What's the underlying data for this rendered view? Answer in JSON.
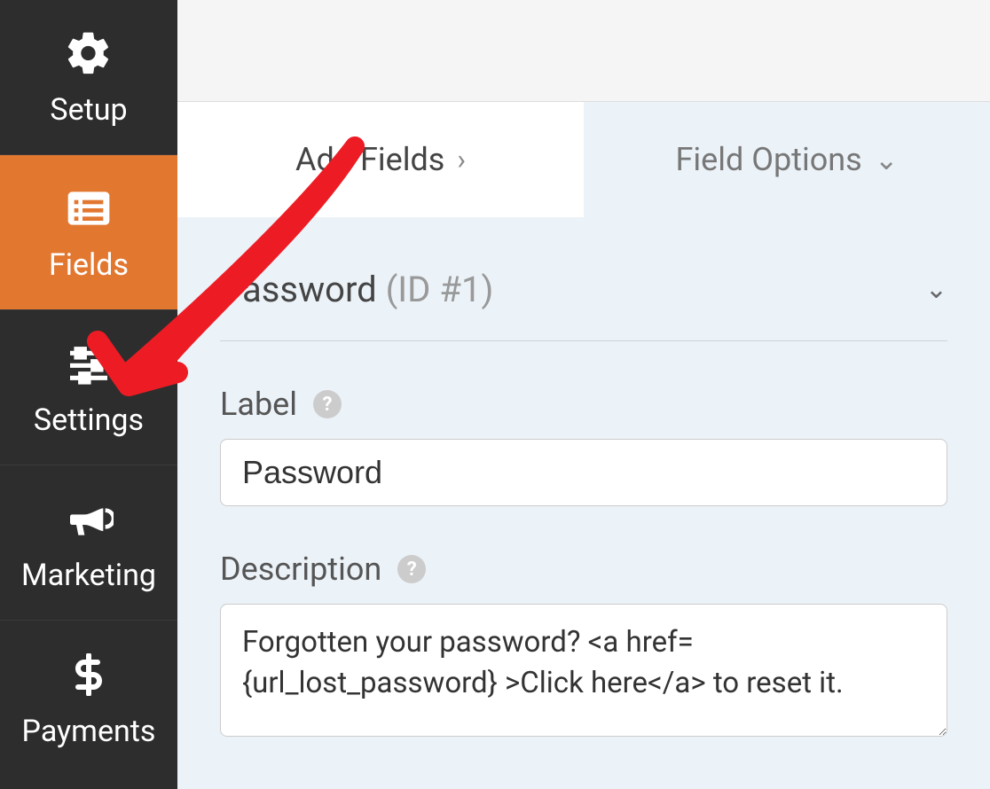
{
  "sidebar": {
    "items": [
      {
        "label": "Setup"
      },
      {
        "label": "Fields"
      },
      {
        "label": "Settings"
      },
      {
        "label": "Marketing"
      },
      {
        "label": "Payments"
      }
    ]
  },
  "tabs": {
    "add_fields": "Add Fields",
    "field_options": "Field Options"
  },
  "section": {
    "title": "Password",
    "id_label": "(ID #1)"
  },
  "form": {
    "label_title": "Label",
    "label_value": "Password",
    "desc_title": "Description",
    "desc_value": "Forgotten your password? <a href={url_lost_password} >Click here</a> to reset it."
  }
}
